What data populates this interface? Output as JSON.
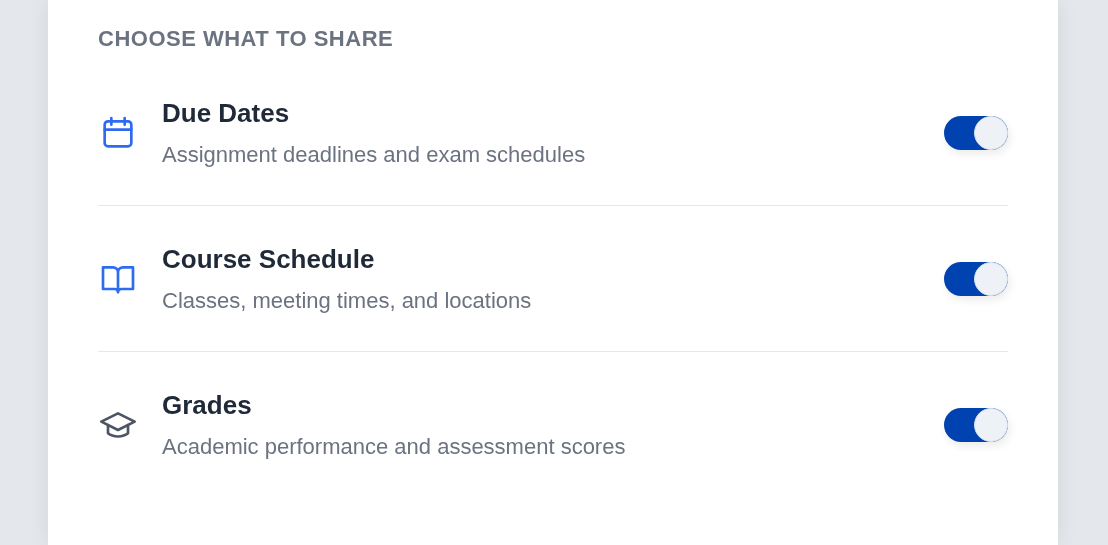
{
  "section_title": "CHOOSE WHAT TO SHARE",
  "items": [
    {
      "kind": "calendar",
      "title": "Due Dates",
      "description": "Assignment deadlines and exam schedules",
      "on": true
    },
    {
      "kind": "book",
      "title": "Course Schedule",
      "description": "Classes, meeting times, and locations",
      "on": true
    },
    {
      "kind": "cap",
      "title": "Grades",
      "description": "Academic performance and assessment scores",
      "on": true
    }
  ]
}
